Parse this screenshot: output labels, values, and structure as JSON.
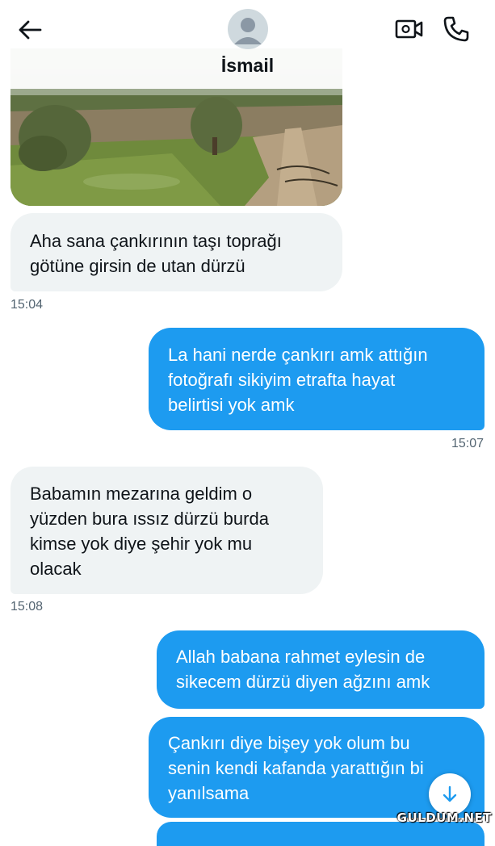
{
  "header": {
    "contact_name": "İsmail",
    "back_icon": "arrow-left-icon",
    "video_icon": "video-call-icon",
    "call_icon": "phone-icon"
  },
  "colors": {
    "outgoing_bubble": "#1d9bf0",
    "incoming_bubble": "#eff3f4",
    "timestamp": "#536471"
  },
  "messages": [
    {
      "direction": "in",
      "lines": [
        "Aha sana çankırının taşı toprağı",
        "götüne girsin de utan dürzü"
      ],
      "time": "15:04"
    },
    {
      "direction": "out",
      "lines": [
        "La hani nerde çankırı amk attığın",
        "fotoğrafı sikiyim etrafta hayat",
        "belirtisi yok amk"
      ],
      "time": "15:07"
    },
    {
      "direction": "in",
      "lines": [
        "Babamın mezarına geldim o",
        "yüzden bura ıssız dürzü burda",
        "kimse yok diye şehir yok mu",
        "olacak"
      ],
      "time": "15:08"
    },
    {
      "direction": "out",
      "lines": [
        "Allah babana rahmet eylesin de",
        "sikecem dürzü diyen ağzını amk"
      ]
    },
    {
      "direction": "out",
      "lines": [
        "Çankırı diye bişey yok olum bu",
        "senin kendi kafanda yarattığın bi",
        "yanılsama"
      ]
    }
  ],
  "watermark": "GULDUM.NET"
}
